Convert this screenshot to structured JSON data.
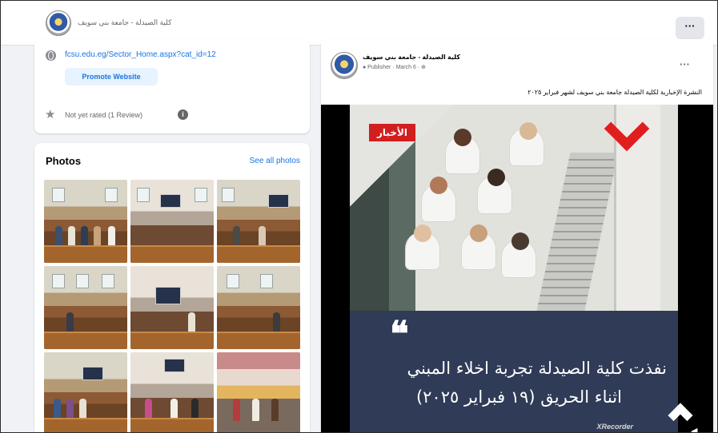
{
  "header": {
    "page_name": "كلية الصيدلة - جامعة بني سويف",
    "more_label": "···"
  },
  "intro": {
    "website": "fcsu.edu.eg/Sector_Home.aspx?cat_id=12",
    "promote_label": "Promote Website",
    "rating": "Not yet rated (1 Review)",
    "info_glyph": "i"
  },
  "photos": {
    "title": "Photos",
    "see_all": "See all photos",
    "icons": [
      "globe-icon",
      "star-icon",
      "info-icon"
    ]
  },
  "post": {
    "author": "كلية الصيدلة - جامعة بني سويف",
    "meta": "● Publisher · March 6 · ⊕",
    "dots": "···",
    "caption": "النشرة الإخبارية لكلية الصيدلة جامعة بني سويف لشهر فبراير ٢٠٢٥",
    "news_tag": "الأخبار",
    "quote_mark": "❝",
    "headline_line1": "نفذت كلية الصيدلة تجربة اخلاء المبني",
    "headline_line2": "اثناء الحريق (١٩ فبراير ٢٠٢٥)",
    "watermark": "XRecorder",
    "volume_glyph": "◀"
  },
  "colors": {
    "accent": "#1b74e4",
    "news_red": "#d21e1e",
    "banner_navy": "#2f3b57"
  }
}
